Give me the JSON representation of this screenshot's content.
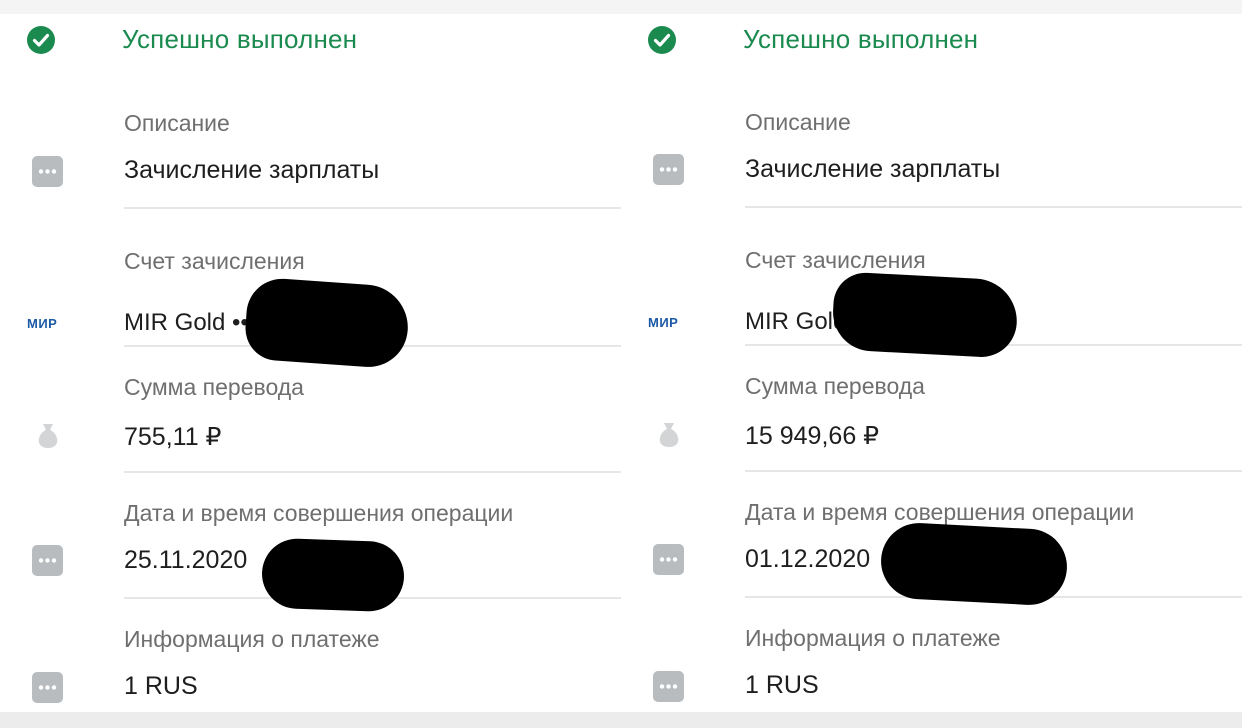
{
  "panels": [
    {
      "status": "Успешно выполнен",
      "description_label": "Описание",
      "description_value": "Зачисление зарплаты",
      "account_label": "Счет зачисления",
      "card_logo": "МИР",
      "account_value": "MIR Gold ••",
      "amount_label": "Сумма перевода",
      "amount_value": "755,11 ₽",
      "datetime_label": "Дата и время совершения операции",
      "datetime_value": "25.11.2020",
      "payment_info_label": "Информация о платеже",
      "payment_info_value": "1 RUS"
    },
    {
      "status": "Успешно выполнен",
      "description_label": "Описание",
      "description_value": "Зачисление зарплаты",
      "account_label": "Счет зачисления",
      "card_logo": "МИР",
      "account_value": "MIR Gold",
      "amount_label": "Сумма перевода",
      "amount_value": "15 949,66 ₽",
      "datetime_label": "Дата и время совершения операции",
      "datetime_value": "01.12.2020",
      "payment_info_label": "Информация о платеже",
      "payment_info_value": "1 RUS"
    }
  ],
  "colors": {
    "success": "#1a8a4e",
    "label": "#6f6f6f",
    "value": "#1e1e1e",
    "icon_gray": "#b9bcbf",
    "mir_blue": "#1d5aa6"
  },
  "icons": [
    "check-circle-icon",
    "more-dots-icon",
    "mir-card-logo",
    "money-bag-icon"
  ]
}
